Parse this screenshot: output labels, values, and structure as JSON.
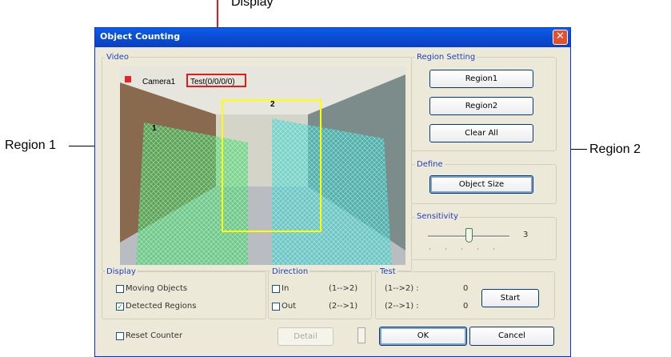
{
  "annotations": {
    "top_label": "Display",
    "region1": "Region 1",
    "region2": "Region 2"
  },
  "dialog": {
    "title": "Object Counting",
    "close_glyph": "✕"
  },
  "video": {
    "group_label": "Video",
    "camera_label": "Camera1",
    "overlay_text": "Test(0/0/0/0)",
    "region_mark_1": "1",
    "region_mark_2": "2"
  },
  "region_setting": {
    "group_label": "Region Setting",
    "region1_button": "Region1",
    "region2_button": "Region2",
    "clear_button": "Clear All"
  },
  "define": {
    "group_label": "Define",
    "object_size_button": "Object Size"
  },
  "sensitivity": {
    "group_label": "Sensitivity",
    "value": "3",
    "level": 3
  },
  "display": {
    "group_label": "Display",
    "moving_objects": "Moving Objects",
    "moving_checked": false,
    "detected_regions": "Detected Regions",
    "detected_checked": true
  },
  "direction": {
    "group_label": "Direction",
    "in_label": "In",
    "in_value": "(1-->2)",
    "out_label": "Out",
    "out_value": "(2-->1)"
  },
  "test": {
    "group_label": "Test",
    "row1_label": "(1-->2) :",
    "row1_count": "0",
    "row2_label": "(2-->1) :",
    "row2_count": "0",
    "start_button": "Start"
  },
  "footer": {
    "reset_counter": "Reset Counter",
    "detail_button": "Detail",
    "ok_button": "OK",
    "cancel_button": "Cancel"
  },
  "colors": {
    "title_bar": "#0a4fd6",
    "highlight_box": "#ffff00",
    "annotation_line": "#e21b1b",
    "region1_fill": "#35d35f",
    "region2_fill": "#2fd0c8"
  }
}
